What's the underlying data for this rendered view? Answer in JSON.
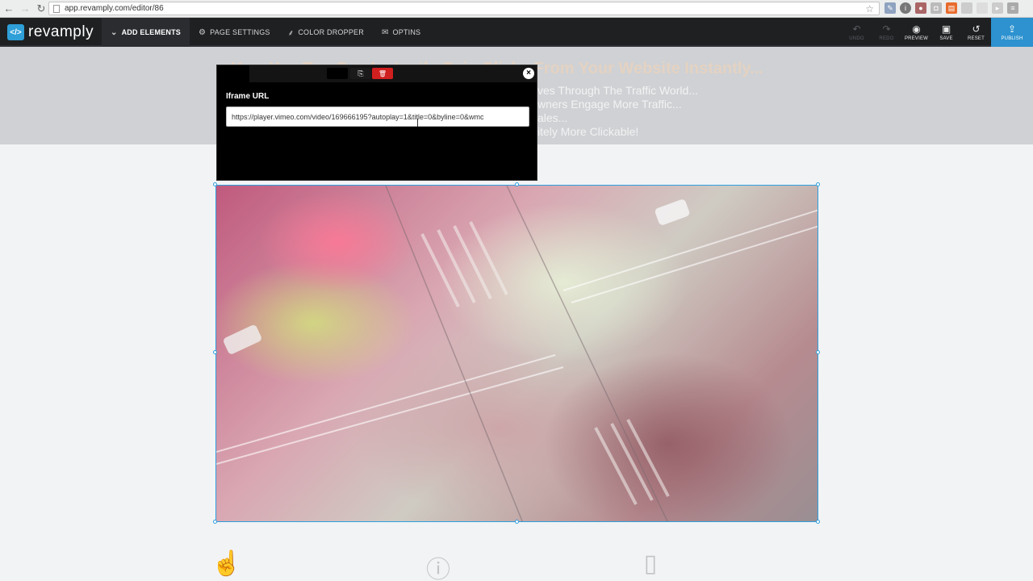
{
  "browser": {
    "url": "app.revamply.com/editor/86",
    "back_icon": "back-arrow-icon",
    "forward_icon": "forward-arrow-icon",
    "reload_icon": "reload-icon"
  },
  "app": {
    "logo_mark": "</>",
    "logo_text": "revamply",
    "brand_color": "#2f9fd8"
  },
  "menu": {
    "items": [
      {
        "label": "ADD ELEMENTS",
        "icon": "chevron-down-icon",
        "glyph": "⌄"
      },
      {
        "label": "PAGE SETTINGS",
        "icon": "gears-icon",
        "glyph": "⚙"
      },
      {
        "label": "COLOR DROPPER",
        "icon": "eyedropper-icon",
        "glyph": "⸙"
      },
      {
        "label": "OPTINS",
        "icon": "envelope-icon",
        "glyph": "✉"
      }
    ]
  },
  "actions": {
    "undo": {
      "label": "UNDO",
      "glyph": "↶"
    },
    "redo": {
      "label": "REDO",
      "glyph": "↷"
    },
    "preview": {
      "label": "PREVIEW",
      "glyph": "◉"
    },
    "save": {
      "label": "SAVE",
      "glyph": "▣"
    },
    "reset": {
      "label": "RESET",
      "glyph": "↺"
    },
    "publish": {
      "label": "PUBLISH",
      "glyph": "⇪"
    }
  },
  "page": {
    "headline": "How You Too Can Instantly Gain Clicks From Your Website Instantly...",
    "sub_lines": [
      "ves Through The Traffic World...",
      "wners Engage More Traffic...",
      "ales...",
      "itely More Clickable!"
    ]
  },
  "popup": {
    "label": "Iframe URL",
    "url_value": "https://player.vimeo.com/video/169666195?autoplay=1&title=0&byline=0&wmc",
    "copy_glyph": "⎘",
    "delete_glyph": "🗑",
    "close_glyph": "×"
  },
  "feature_icons": [
    {
      "name": "pointer-hand-icon",
      "glyph": "☝"
    },
    {
      "name": "alert-circle-icon",
      "glyph": "ⓘ"
    },
    {
      "name": "mobile-dollar-icon",
      "glyph": "▯"
    }
  ]
}
